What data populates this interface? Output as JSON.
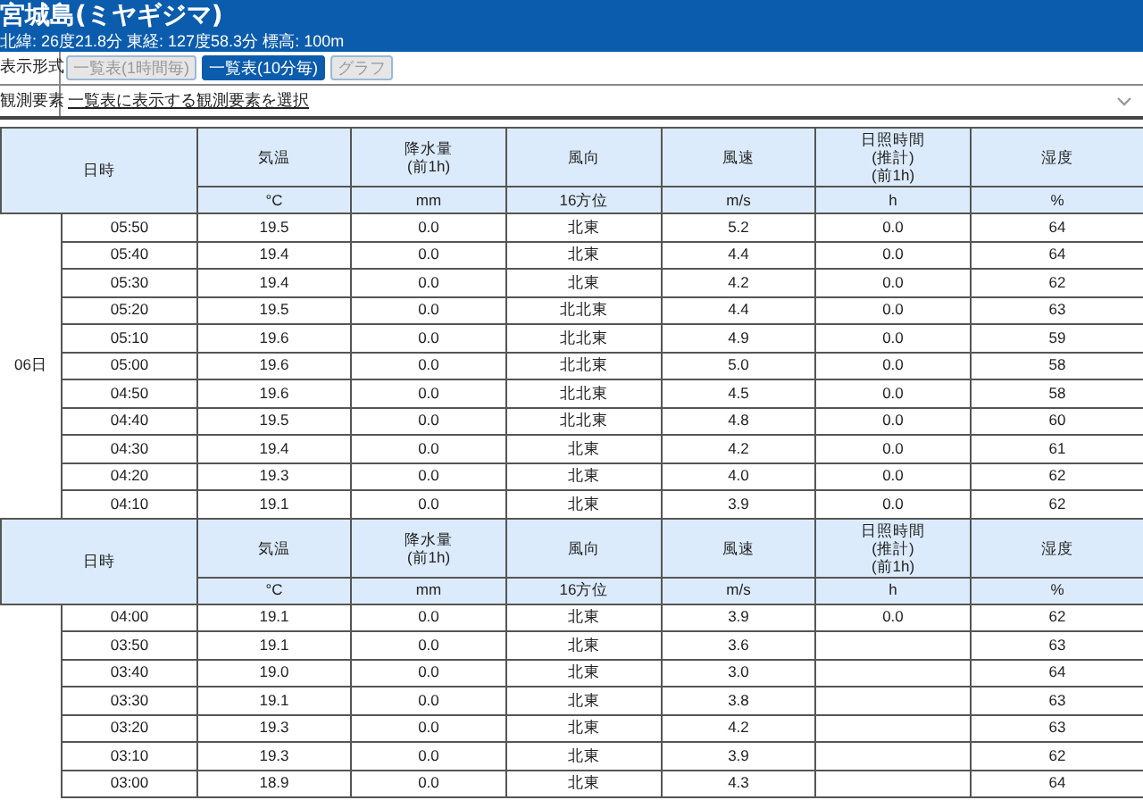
{
  "header": {
    "title": "宮城島(ミヤギジマ)",
    "subtitle": "北緯: 26度21.8分 東経: 127度58.3分 標高: 100m"
  },
  "display_format": {
    "label": "表示形式",
    "buttons": [
      {
        "label": "一覧表(1時間毎)",
        "selected": false
      },
      {
        "label": "一覧表(10分毎)",
        "selected": true
      },
      {
        "label": "グラフ",
        "selected": false
      }
    ]
  },
  "elements": {
    "label": "観測要素",
    "link": "一覧表に表示する観測要素を選択"
  },
  "groups": [
    {
      "datetime_label": "日時",
      "date": "06日",
      "columns": [
        {
          "name": "気温",
          "unit": "°C"
        },
        {
          "name": "降水量\n(前1h)",
          "unit": "mm"
        },
        {
          "name": "風向",
          "unit": "16方位"
        },
        {
          "name": "風速",
          "unit": "m/s"
        },
        {
          "name": "日照時間\n(推計)\n(前1h)",
          "unit": "h"
        },
        {
          "name": "湿度",
          "unit": "%"
        }
      ],
      "rows": [
        {
          "time": "05:50",
          "temperature": "19.5",
          "precipitation": "0.0",
          "wind_direction": "北東",
          "wind_speed": "5.2",
          "sunshine": "0.0",
          "humidity": "64"
        },
        {
          "time": "05:40",
          "temperature": "19.4",
          "precipitation": "0.0",
          "wind_direction": "北東",
          "wind_speed": "4.4",
          "sunshine": "0.0",
          "humidity": "64"
        },
        {
          "time": "05:30",
          "temperature": "19.4",
          "precipitation": "0.0",
          "wind_direction": "北東",
          "wind_speed": "4.2",
          "sunshine": "0.0",
          "humidity": "62"
        },
        {
          "time": "05:20",
          "temperature": "19.5",
          "precipitation": "0.0",
          "wind_direction": "北北東",
          "wind_speed": "4.4",
          "sunshine": "0.0",
          "humidity": "63"
        },
        {
          "time": "05:10",
          "temperature": "19.6",
          "precipitation": "0.0",
          "wind_direction": "北北東",
          "wind_speed": "4.9",
          "sunshine": "0.0",
          "humidity": "59"
        },
        {
          "time": "05:00",
          "temperature": "19.6",
          "precipitation": "0.0",
          "wind_direction": "北北東",
          "wind_speed": "5.0",
          "sunshine": "0.0",
          "humidity": "58"
        },
        {
          "time": "04:50",
          "temperature": "19.6",
          "precipitation": "0.0",
          "wind_direction": "北北東",
          "wind_speed": "4.5",
          "sunshine": "0.0",
          "humidity": "58"
        },
        {
          "time": "04:40",
          "temperature": "19.5",
          "precipitation": "0.0",
          "wind_direction": "北北東",
          "wind_speed": "4.8",
          "sunshine": "0.0",
          "humidity": "60"
        },
        {
          "time": "04:30",
          "temperature": "19.4",
          "precipitation": "0.0",
          "wind_direction": "北東",
          "wind_speed": "4.2",
          "sunshine": "0.0",
          "humidity": "61"
        },
        {
          "time": "04:20",
          "temperature": "19.3",
          "precipitation": "0.0",
          "wind_direction": "北東",
          "wind_speed": "4.0",
          "sunshine": "0.0",
          "humidity": "62"
        },
        {
          "time": "04:10",
          "temperature": "19.1",
          "precipitation": "0.0",
          "wind_direction": "北東",
          "wind_speed": "3.9",
          "sunshine": "0.0",
          "humidity": "62"
        }
      ]
    },
    {
      "datetime_label": "日時",
      "columns": [
        {
          "name": "気温",
          "unit": "°C"
        },
        {
          "name": "降水量\n(前1h)",
          "unit": "mm"
        },
        {
          "name": "風向",
          "unit": "16方位"
        },
        {
          "name": "風速",
          "unit": "m/s"
        },
        {
          "name": "日照時間\n(推計)\n(前1h)",
          "unit": "h"
        },
        {
          "name": "湿度",
          "unit": "%"
        }
      ],
      "rows": [
        {
          "time": "04:00",
          "temperature": "19.1",
          "precipitation": "0.0",
          "wind_direction": "北東",
          "wind_speed": "3.9",
          "sunshine": "0.0",
          "humidity": "62"
        },
        {
          "time": "03:50",
          "temperature": "19.1",
          "precipitation": "0.0",
          "wind_direction": "北東",
          "wind_speed": "3.6",
          "humidity": "63"
        },
        {
          "time": "03:40",
          "temperature": "19.0",
          "precipitation": "0.0",
          "wind_direction": "北東",
          "wind_speed": "3.0",
          "humidity": "64"
        },
        {
          "time": "03:30",
          "temperature": "19.1",
          "precipitation": "0.0",
          "wind_direction": "北東",
          "wind_speed": "3.8",
          "humidity": "63"
        },
        {
          "time": "03:20",
          "temperature": "19.3",
          "precipitation": "0.0",
          "wind_direction": "北東",
          "wind_speed": "4.2",
          "humidity": "63"
        },
        {
          "time": "03:10",
          "temperature": "19.3",
          "precipitation": "0.0",
          "wind_direction": "北東",
          "wind_speed": "3.9",
          "humidity": "62"
        },
        {
          "time": "03:00",
          "temperature": "18.9",
          "precipitation": "0.0",
          "wind_direction": "北東",
          "wind_speed": "4.3",
          "humidity": "64"
        }
      ]
    }
  ]
}
